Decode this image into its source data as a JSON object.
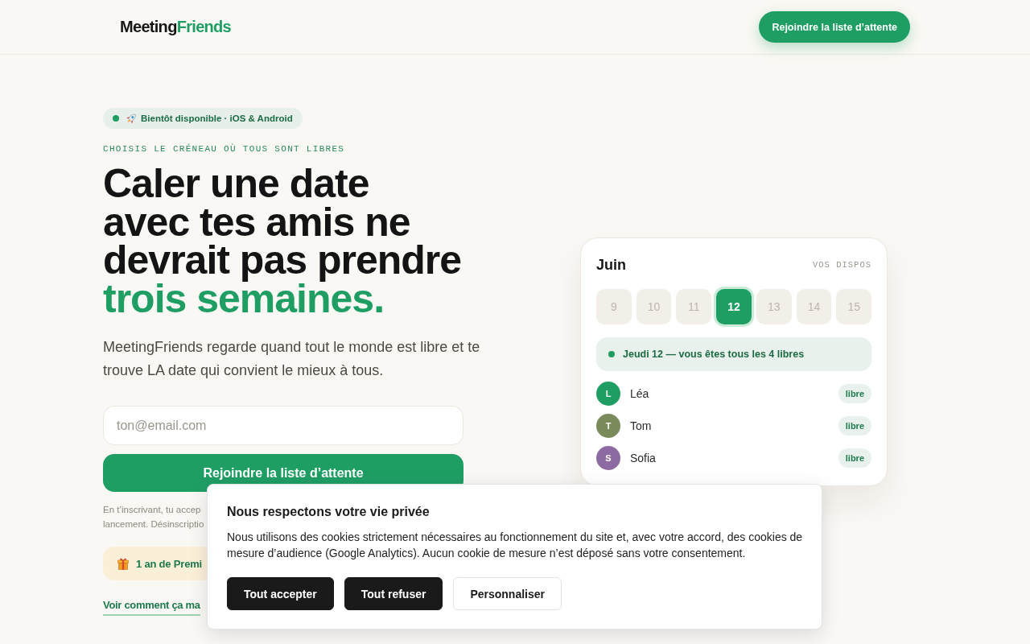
{
  "header": {
    "logo": {
      "text": "Meeting",
      "accent": "Friends"
    },
    "cta": "Rejoindre la liste d’attente"
  },
  "hero": {
    "badge": "Bientôt disponible · iOS & Android",
    "eyebrow": "CHOISIS LE CRÉNEAU OÙ TOUS SONT LIBRES",
    "headline": {
      "lines": [
        "Caler une date",
        "avec tes amis ne",
        "devrait pas prendre"
      ],
      "highlight": "trois semaines."
    },
    "intro": "MeetingFriends regarde quand tout le monde est libre et te trouve LA date qui convient le mieux à tous.",
    "email": {
      "placeholder": "ton@email.com"
    },
    "submit": "Rejoindre la liste d’attente",
    "legal_lines": [
      "En t’inscrivant, tu accep",
      "lancement. Désinscriptio"
    ],
    "perk": "1 an de Premi",
    "link": "Voir comment ça ma"
  },
  "calendar": {
    "month": "Juin",
    "caption": "VOS DISPOS",
    "days": [
      {
        "label": "9",
        "selected": false
      },
      {
        "label": "10",
        "selected": false
      },
      {
        "label": "11",
        "selected": false
      },
      {
        "label": "12",
        "selected": true
      },
      {
        "label": "13",
        "selected": false
      },
      {
        "label": "14",
        "selected": false
      },
      {
        "label": "15",
        "selected": false
      }
    ],
    "summary": "Jeudi 12 — vous êtes tous les 4 libres",
    "people": [
      {
        "initial": "L",
        "name": "Léa",
        "color": "#1f9e64",
        "status": "libre"
      },
      {
        "initial": "T",
        "name": "Tom",
        "color": "#7b8a5a",
        "status": "libre"
      },
      {
        "initial": "S",
        "name": "Sofia",
        "color": "#8d6aa1",
        "status": "libre"
      }
    ]
  },
  "cookie_banner": {
    "title": "Nous respectons votre vie privée",
    "text": "Nous utilisons des cookies strictement nécessaires au fonctionnement du site et, avec votre accord, des cookies de mesure d’audience (Google Analytics). Aucun cookie de mesure n’est déposé sans votre consentement.",
    "buttons": [
      {
        "label": "Tout accepter",
        "kind": "filled"
      },
      {
        "label": "Tout refuser",
        "kind": "filled"
      },
      {
        "label": "Personnaliser",
        "kind": "outline"
      }
    ]
  }
}
